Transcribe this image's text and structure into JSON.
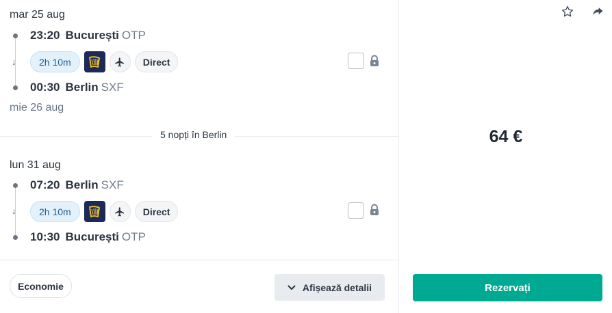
{
  "outbound": {
    "date": "mar 25 aug",
    "departure": {
      "time": "23:20",
      "city": "București",
      "code": "OTP"
    },
    "duration": "2h 10m",
    "airline_icon": "ryanair-harp-logo",
    "stops": "Direct",
    "arrival": {
      "time": "00:30",
      "city": "Berlin",
      "code": "SXF"
    },
    "arrival_date": "mie 26 aug"
  },
  "stay": {
    "label": "5 nopți în Berlin"
  },
  "inbound": {
    "date": "lun 31 aug",
    "departure": {
      "time": "07:20",
      "city": "Berlin",
      "code": "SXF"
    },
    "duration": "2h 10m",
    "airline_icon": "ryanair-harp-logo",
    "stops": "Direct",
    "arrival": {
      "time": "10:30",
      "city": "București",
      "code": "OTP"
    }
  },
  "footer": {
    "cabin_class": "Economie",
    "details_label": "Afișează detalii"
  },
  "sidebar": {
    "price": "64 €",
    "book_label": "Rezervați"
  },
  "colors": {
    "accent": "#00a991",
    "duration_chip_bg": "#e3f1fb",
    "airline_logo_bg": "#1c2a55",
    "airline_logo_fg": "#f2c230"
  }
}
